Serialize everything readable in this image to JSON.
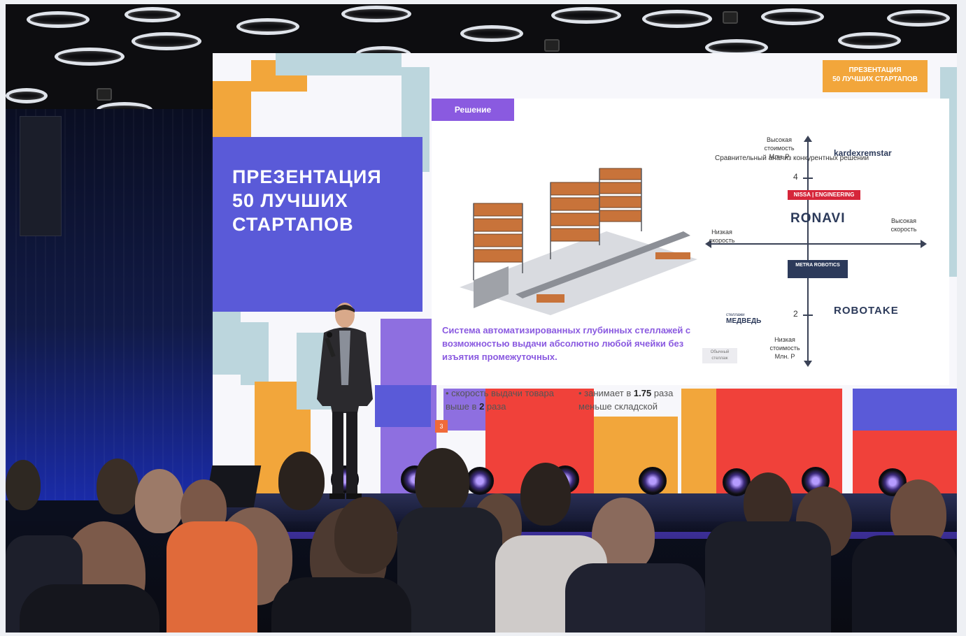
{
  "slide": {
    "left_title": [
      "ПРЕЗЕНТАЦИЯ",
      "50 ЛУЧШИХ",
      "СТАРТАПОВ"
    ],
    "section_tag": "Решение",
    "corner_tag": [
      "ПРЕЗЕНТАЦИЯ",
      "50 ЛУЧШИХ СТАРТАПОВ"
    ],
    "description": "Система автоматизированных глубинных стеллажей с возможностью выдачи абсолютно любой ячейки без изъятия промежуточных.",
    "bullet1_text": "скорость выдачи товара выше в",
    "bullet1_value": "2",
    "bullet1_unit": "раза",
    "bullet2_text": "занимает в",
    "bullet2_value": "1.75",
    "bullet2_unit": "раза меньше складской",
    "page_number": "3",
    "chart": {
      "title": "Сравнительный анализ конкурентных решений",
      "y_top_label": "Высокая стоимость Млн. Р",
      "y_bottom_label": "Низкая стоимость Млн. Р",
      "x_left_label": "Низкая скорость",
      "x_right_label": "Высокая скорость",
      "tick_4": "4",
      "tick_2": "2",
      "brands": {
        "kardex": "kardexremstar",
        "nissa": "NISSA | ENGINEERING",
        "ronavi": "RONAVI",
        "metra": "METRA ROBOTICS",
        "robotake": "ROBOTAKE",
        "medved": "МЕДВЕДЬ",
        "medved_sub": "стеллажи",
        "ordinary": "Обычный стеллаж"
      }
    }
  },
  "colors": {
    "purple": "#8a5ae0",
    "blue_block": "#5a5ad8",
    "orange": "#f2a63b",
    "red": "#f0413a",
    "teal": "#bcd6dd"
  }
}
